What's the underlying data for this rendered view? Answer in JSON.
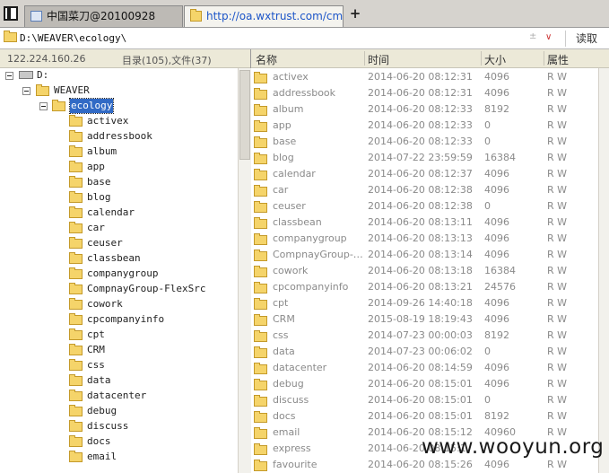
{
  "tabs": [
    {
      "title": "中国菜刀@20100928",
      "active": false
    },
    {
      "title": "http://oa.wxtrust.com/cmd.jsp",
      "active": true
    }
  ],
  "new_tab_label": "+",
  "address": {
    "path": "D:\\WEAVER\\ecology\\",
    "history_icon": "±",
    "dropdown_icon": "∨",
    "read_button": "读取"
  },
  "info": {
    "ip": "122.224.160.26",
    "counts": "目录(105),文件(37)"
  },
  "tree": {
    "drive": "D:",
    "root": "WEAVER",
    "current": "ecology",
    "children": [
      "activex",
      "addressbook",
      "album",
      "app",
      "base",
      "blog",
      "calendar",
      "car",
      "ceuser",
      "classbean",
      "companygroup",
      "CompnayGroup-FlexSrc",
      "cowork",
      "cpcompanyinfo",
      "cpt",
      "CRM",
      "css",
      "data",
      "datacenter",
      "debug",
      "discuss",
      "docs",
      "email"
    ]
  },
  "columns": {
    "name": "名称",
    "time": "时间",
    "size": "大小",
    "attr": "属性"
  },
  "files": [
    {
      "name": "activex",
      "time": "2014-06-20 08:12:31",
      "size": "4096",
      "attr": "R W"
    },
    {
      "name": "addressbook",
      "time": "2014-06-20 08:12:31",
      "size": "4096",
      "attr": "R W"
    },
    {
      "name": "album",
      "time": "2014-06-20 08:12:33",
      "size": "8192",
      "attr": "R W"
    },
    {
      "name": "app",
      "time": "2014-06-20 08:12:33",
      "size": "0",
      "attr": "R W"
    },
    {
      "name": "base",
      "time": "2014-06-20 08:12:33",
      "size": "0",
      "attr": "R W"
    },
    {
      "name": "blog",
      "time": "2014-07-22 23:59:59",
      "size": "16384",
      "attr": "R W"
    },
    {
      "name": "calendar",
      "time": "2014-06-20 08:12:37",
      "size": "4096",
      "attr": "R W"
    },
    {
      "name": "car",
      "time": "2014-06-20 08:12:38",
      "size": "4096",
      "attr": "R W"
    },
    {
      "name": "ceuser",
      "time": "2014-06-20 08:12:38",
      "size": "0",
      "attr": "R W"
    },
    {
      "name": "classbean",
      "time": "2014-06-20 08:13:11",
      "size": "4096",
      "attr": "R W"
    },
    {
      "name": "companygroup",
      "time": "2014-06-20 08:13:13",
      "size": "4096",
      "attr": "R W"
    },
    {
      "name": "CompnayGroup-Flex...",
      "time": "2014-06-20 08:13:14",
      "size": "4096",
      "attr": "R W"
    },
    {
      "name": "cowork",
      "time": "2014-06-20 08:13:18",
      "size": "16384",
      "attr": "R W"
    },
    {
      "name": "cpcompanyinfo",
      "time": "2014-06-20 08:13:21",
      "size": "24576",
      "attr": "R W"
    },
    {
      "name": "cpt",
      "time": "2014-09-26 14:40:18",
      "size": "4096",
      "attr": "R W"
    },
    {
      "name": "CRM",
      "time": "2015-08-19 18:19:43",
      "size": "4096",
      "attr": "R W"
    },
    {
      "name": "css",
      "time": "2014-07-23 00:00:03",
      "size": "8192",
      "attr": "R W"
    },
    {
      "name": "data",
      "time": "2014-07-23 00:06:02",
      "size": "0",
      "attr": "R W"
    },
    {
      "name": "datacenter",
      "time": "2014-06-20 08:14:59",
      "size": "4096",
      "attr": "R W"
    },
    {
      "name": "debug",
      "time": "2014-06-20 08:15:01",
      "size": "4096",
      "attr": "R W"
    },
    {
      "name": "discuss",
      "time": "2014-06-20 08:15:01",
      "size": "0",
      "attr": "R W"
    },
    {
      "name": "docs",
      "time": "2014-06-20 08:15:01",
      "size": "8192",
      "attr": "R W"
    },
    {
      "name": "email",
      "time": "2014-06-20 08:15:12",
      "size": "40960",
      "attr": "R W"
    },
    {
      "name": "express",
      "time": "2014-06-20 08:15:1",
      "size": "",
      "attr": ""
    },
    {
      "name": "favourite",
      "time": "2014-06-20 08:15:26",
      "size": "4096",
      "attr": "R W"
    }
  ],
  "watermark": "www.wooyun.org"
}
